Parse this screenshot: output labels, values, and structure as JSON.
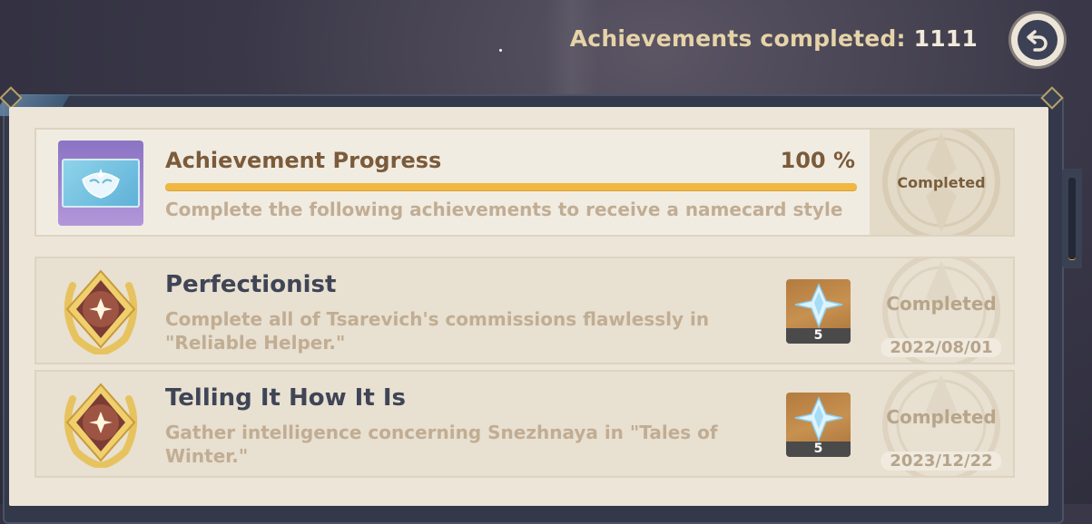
{
  "header": {
    "count_label": "Achievements completed:",
    "count_value": "1111",
    "back_button_icon": "back-arrow-icon"
  },
  "progress_card": {
    "title": "Achievement Progress",
    "percent_text": "100 %",
    "progress_fraction": 1.0,
    "description": "Complete the following achievements to receive a namecard style",
    "status": "Completed",
    "icon": "namecard-icon"
  },
  "achievements": [
    {
      "title": "Perfectionist",
      "description_line1": "Complete all of Tsarevich's commissions flawlessly in",
      "description_line2": "\"Reliable Helper.\"",
      "reward_icon": "primogem-icon",
      "reward_count": "5",
      "status": "Completed",
      "date": "2022/08/01"
    },
    {
      "title": "Telling It How It Is",
      "description_line1": "Gather intelligence concerning Snezhnaya in \"Tales of",
      "description_line2": "Winter.\"",
      "reward_icon": "primogem-icon",
      "reward_count": "5",
      "status": "Completed",
      "date": "2023/12/22"
    }
  ],
  "colors": {
    "progress_bar": "#f1b73f",
    "panel_bg": "#ece5d8",
    "title_brown": "#7b5b3a",
    "desc_tan": "#c1ad93"
  }
}
